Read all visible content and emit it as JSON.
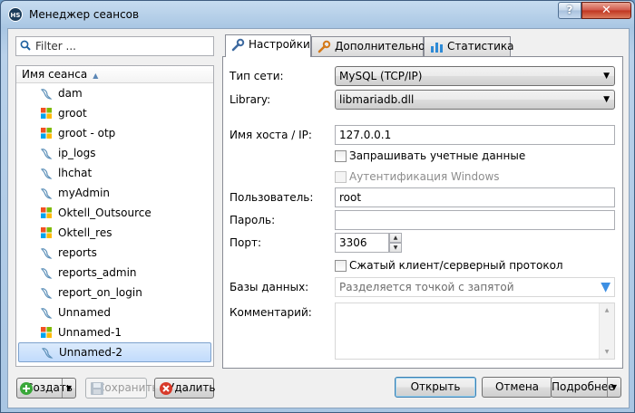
{
  "window": {
    "title": "Менеджер сеансов",
    "app_icon_text": "HS",
    "help_label": "?",
    "close_label": "✕"
  },
  "filter": {
    "placeholder": "Filter ..."
  },
  "session_list": {
    "header": "Имя сеанса",
    "items": [
      {
        "label": "dam",
        "icon": "mysql-dolphin-icon"
      },
      {
        "label": "groot",
        "icon": "windows-logo-icon"
      },
      {
        "label": "groot - otp",
        "icon": "windows-logo-icon"
      },
      {
        "label": "ip_logs",
        "icon": "mysql-dolphin-icon"
      },
      {
        "label": "lhchat",
        "icon": "mysql-dolphin-icon"
      },
      {
        "label": "myAdmin",
        "icon": "mysql-dolphin-icon"
      },
      {
        "label": "Oktell_Outsource",
        "icon": "windows-logo-icon"
      },
      {
        "label": "Oktell_res",
        "icon": "windows-logo-icon"
      },
      {
        "label": "reports",
        "icon": "mysql-dolphin-icon"
      },
      {
        "label": "reports_admin",
        "icon": "mysql-dolphin-icon"
      },
      {
        "label": "report_on_login",
        "icon": "mysql-dolphin-icon"
      },
      {
        "label": "Unnamed",
        "icon": "mysql-dolphin-icon"
      },
      {
        "label": "Unnamed-1",
        "icon": "windows-logo-icon"
      },
      {
        "label": "Unnamed-2",
        "icon": "mysql-dolphin-icon"
      }
    ],
    "selected": "Unnamed-2"
  },
  "tabs": [
    {
      "label": "Настройки",
      "active": true
    },
    {
      "label": "Дополнительно",
      "active": false
    },
    {
      "label": "Статистика",
      "active": false
    }
  ],
  "settings": {
    "network_type_label": "Тип сети:",
    "network_type_value": "MySQL (TCP/IP)",
    "library_label": "Library:",
    "library_value": "libmariadb.dll",
    "host_label": "Имя хоста / IP:",
    "host_value": "127.0.0.1",
    "prompt_credentials_label": "Запрашивать учетные данные",
    "windows_auth_label": "Аутентификация Windows",
    "user_label": "Пользователь:",
    "user_value": "root",
    "password_label": "Пароль:",
    "password_value": "",
    "port_label": "Порт:",
    "port_value": "3306",
    "compressed_label": "Сжатый клиент/серверный протокол",
    "databases_label": "Базы данных:",
    "databases_placeholder": "Разделяется точкой с запятой",
    "comment_label": "Комментарий:",
    "comment_value": ""
  },
  "buttons": {
    "new": "Создать",
    "save": "Сохранить",
    "delete": "Удалить",
    "open": "Открыть",
    "cancel": "Отмена",
    "more": "Подробнее"
  },
  "colors": {
    "accent_blue": "#3d8fe3",
    "selection": "#c1dbfc"
  }
}
